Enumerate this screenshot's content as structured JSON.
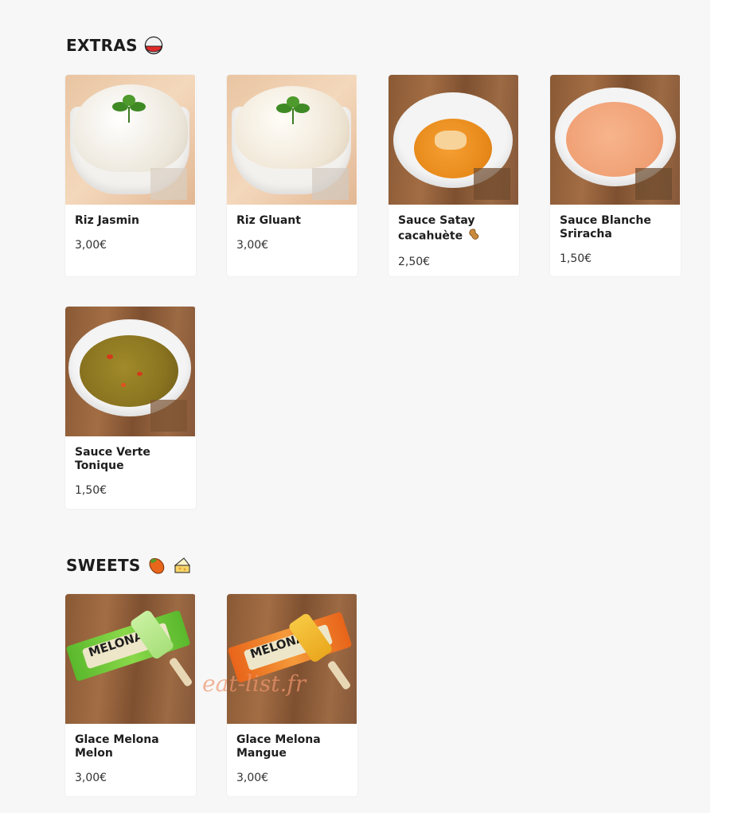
{
  "sections": [
    {
      "title": "EXTRAS",
      "emoji_icon": "rice-bowl-icon",
      "items": [
        {
          "name": "Riz Jasmin",
          "price": "3,00€",
          "image": "jasmine-rice-photo"
        },
        {
          "name": "Riz Gluant",
          "price": "3,00€",
          "image": "sticky-rice-photo"
        },
        {
          "name": "Sauce Satay cacahuète",
          "name_emoji": "peanut-icon",
          "price": "2,50€",
          "image": "satay-sauce-photo"
        },
        {
          "name": "Sauce Blanche Sriracha",
          "price": "1,50€",
          "image": "sriracha-white-sauce-photo"
        },
        {
          "name": "Sauce Verte Tonique",
          "price": "1,50€",
          "image": "green-sauce-photo"
        }
      ]
    },
    {
      "title": "SWEETS",
      "emoji_icons": [
        "mango-icon",
        "cheesecake-icon"
      ],
      "items": [
        {
          "name": "Glace Melona Melon",
          "price": "3,00€",
          "image": "melona-melon-photo",
          "pack_text": "MELONA"
        },
        {
          "name": "Glace Melona Mangue",
          "price": "3,00€",
          "image": "melona-mango-photo",
          "pack_text": "MELONA"
        }
      ]
    }
  ],
  "watermark": "eat-list.fr",
  "colors": {
    "page_bg": "#f7f7f7",
    "card_bg": "#ffffff",
    "text": "#1c1c1c",
    "watermark": "#f0966e"
  }
}
